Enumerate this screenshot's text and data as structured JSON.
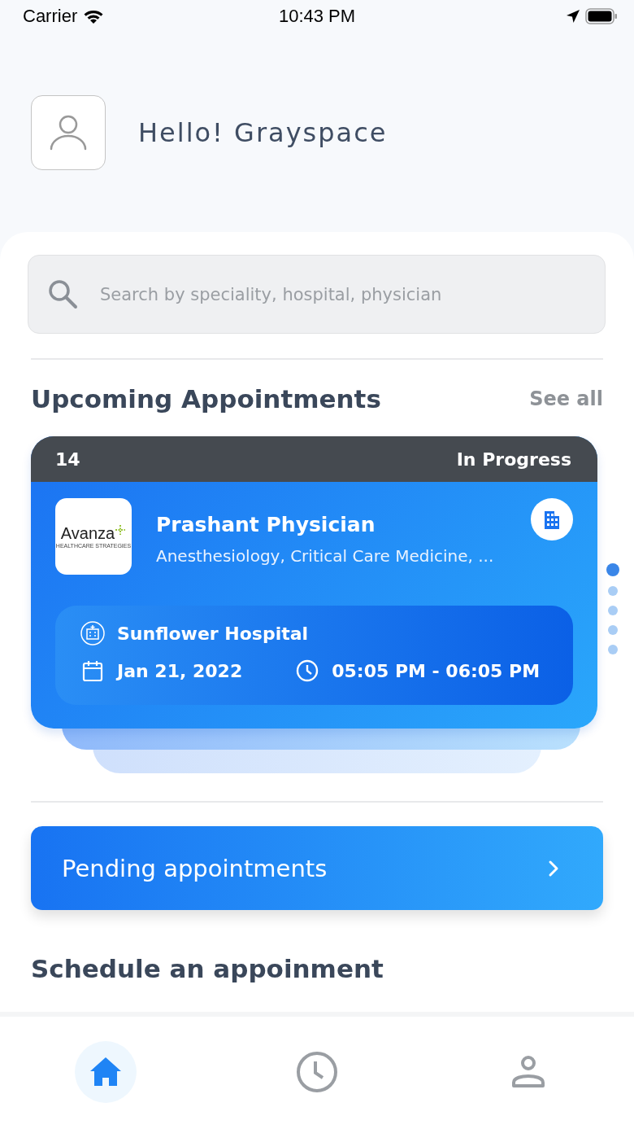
{
  "status_bar": {
    "carrier": "Carrier",
    "time": "10:43 PM"
  },
  "greeting": "Hello! Grayspace",
  "search": {
    "placeholder": "Search by speciality, hospital, physician"
  },
  "upcoming": {
    "title": "Upcoming Appointments",
    "see_all": "See all",
    "card": {
      "number": "14",
      "status": "In Progress",
      "logo": {
        "name": "Avanza",
        "tagline": "HEALTHCARE STRATEGIES"
      },
      "physician": "Prashant Physician",
      "specialities": "Anesthesiology, Critical Care Medicine, ...",
      "hospital": "Sunflower Hospital",
      "date": "Jan 21, 2022",
      "time": "05:05 PM - 06:05 PM"
    },
    "pager": [
      {
        "selected": true
      },
      {
        "selected": false
      },
      {
        "selected": false
      },
      {
        "selected": false
      },
      {
        "selected": false
      }
    ]
  },
  "pending_button": "Pending appointments",
  "schedule_title": "Schedule an appoinment",
  "tab_bar": [
    {
      "kind": "home",
      "selected": true
    },
    {
      "kind": "history",
      "selected": false
    },
    {
      "kind": "profile",
      "selected": false
    }
  ]
}
